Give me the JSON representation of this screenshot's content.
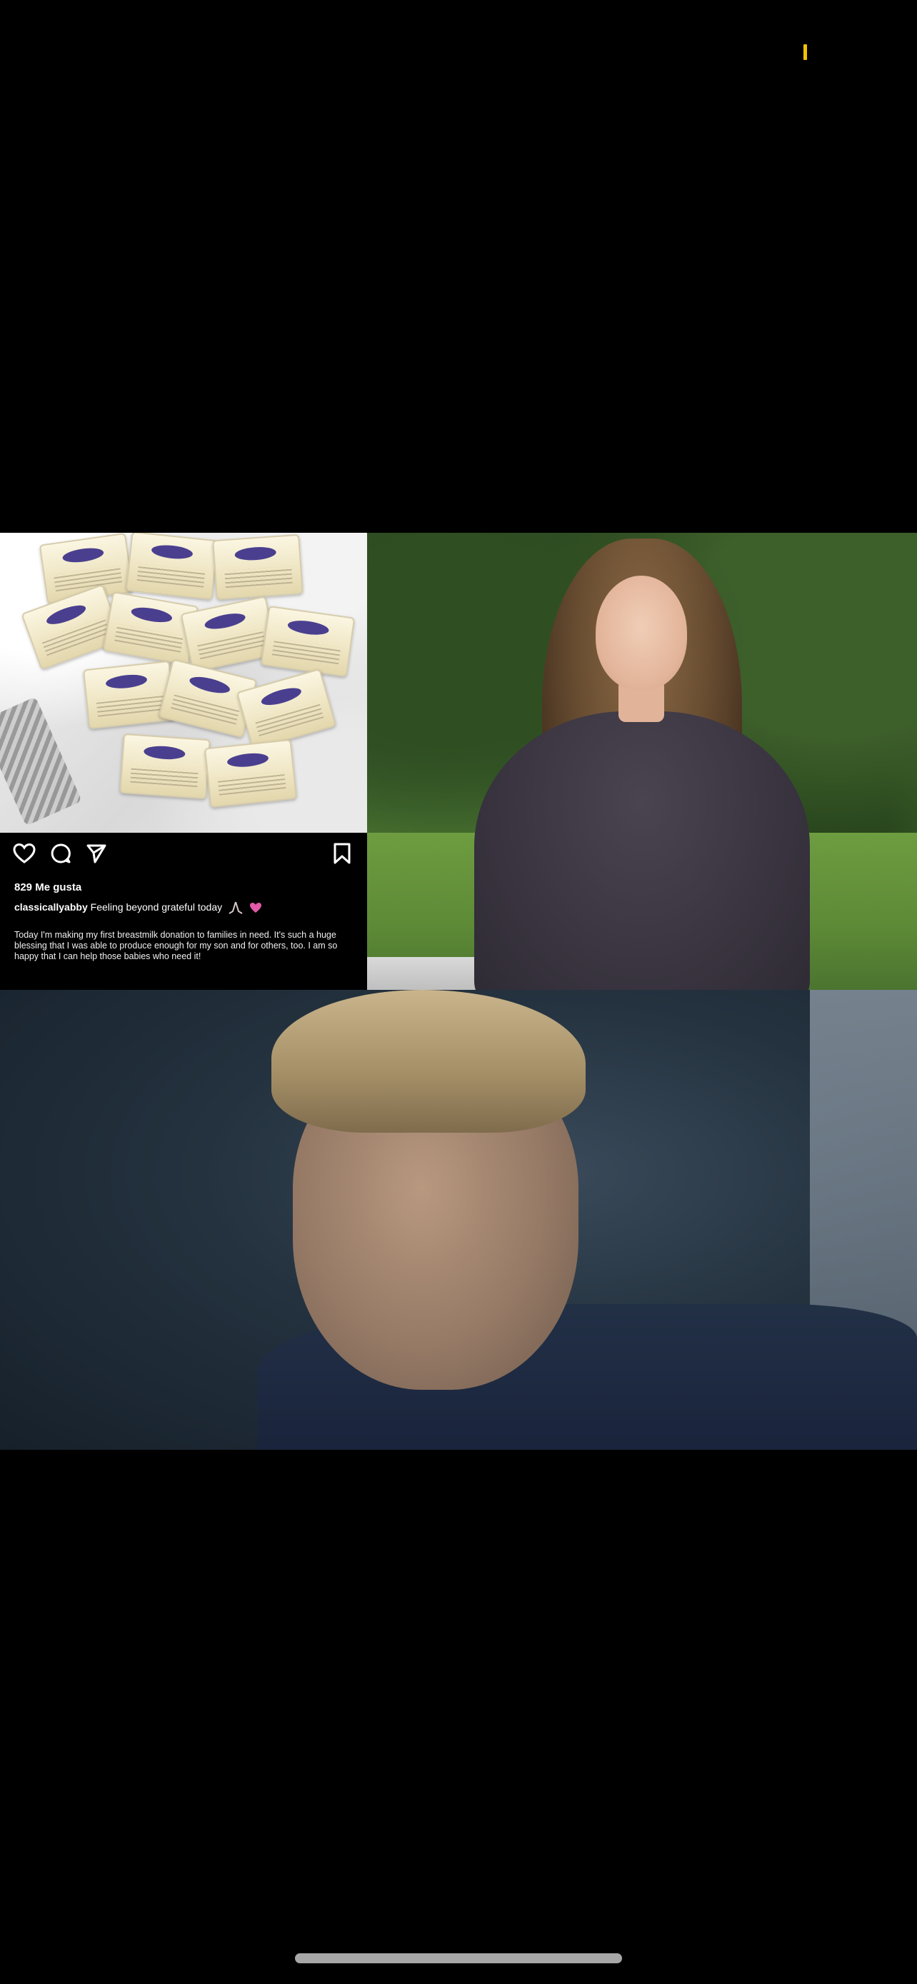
{
  "meme": {
    "instagram_post": {
      "likes": "829 Me gusta",
      "username": "classicallyabby",
      "caption_lead": "Feeling beyond grateful today",
      "caption_body": "Today I'm making my first breastmilk donation to families in need. It's such a huge blessing that I was able to produce enough for my son and for others, too. I am so happy that I can help those babies who need it!"
    }
  },
  "icons": {
    "like": "heart-icon",
    "comment": "comment-icon",
    "share": "share-icon",
    "save": "bookmark-icon",
    "pray": "pray-emoji",
    "heart_emoji": "heart-emoji"
  },
  "colors": {
    "background": "#000000",
    "status_marker": "#f2c200",
    "home_indicator": "#a7a7a7"
  }
}
